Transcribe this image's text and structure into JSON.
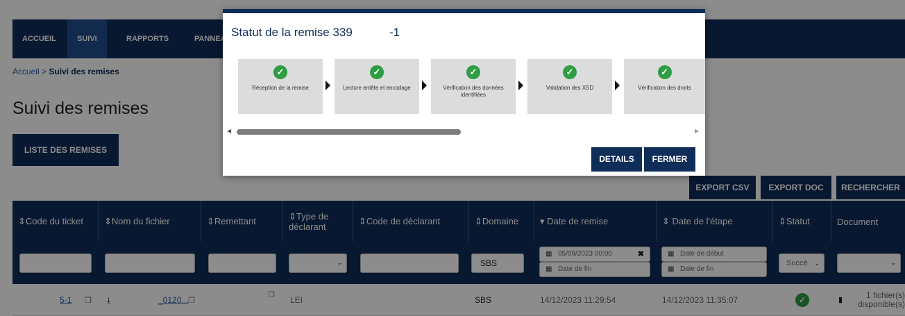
{
  "nav": {
    "items": [
      {
        "label": "ACCUEIL"
      },
      {
        "label": "SUIVI"
      },
      {
        "label": "RAPPORTS"
      },
      {
        "label": "PANNEAU"
      }
    ]
  },
  "breadcrumb": {
    "home": "Accueil",
    "sep": ">",
    "current": "Suivi des remises"
  },
  "page_title": "Suivi des remises",
  "liste_button": "LISTE DES REMISES",
  "actions": {
    "export_csv": "EXPORT CSV",
    "export_doc": "EXPORT DOC",
    "rechercher": "RECHERCHER"
  },
  "table": {
    "headers": [
      "⇕Code du ticket",
      "⇕Nom du fichier",
      "⇕Remettant",
      "⇕Type de déclarant",
      "⇕Code de déclarant",
      "⇕Domaine",
      "▾ Date de remise",
      "⇕ Date de l'étape",
      "⇕Statut",
      "Document"
    ],
    "filters": {
      "domaine": "SBS",
      "date_remise_start": "05/09/2023 00:00",
      "date_remise_end_placeholder": "Date de fin",
      "date_etape_start_placeholder": "Date de début",
      "date_etape_end_placeholder": "Date de fin",
      "statut": "Succè"
    },
    "row": {
      "code_ticket": "5-1",
      "nom_fichier": "_0120...",
      "type_declarant": "LEI",
      "domaine": "SBS",
      "date_remise": "14/12/2023 11:29:54",
      "date_etape": "14/12/2023 11:35:07",
      "document": "1 fichier(s) disponible(s)"
    }
  },
  "modal": {
    "title": "Statut de la remise 339",
    "title_suffix": "-1",
    "steps": [
      {
        "label": "Réception de la remise"
      },
      {
        "label": "Lecture entête et encodage"
      },
      {
        "label": "Vérification des données identifiées"
      },
      {
        "label": "Validation des XSD"
      },
      {
        "label": "Vérification des droits"
      }
    ],
    "details_button": "DETAILS",
    "close_button": "FERMER"
  },
  "colors": {
    "brand": "#0f2d59",
    "success": "#2e9d43"
  }
}
